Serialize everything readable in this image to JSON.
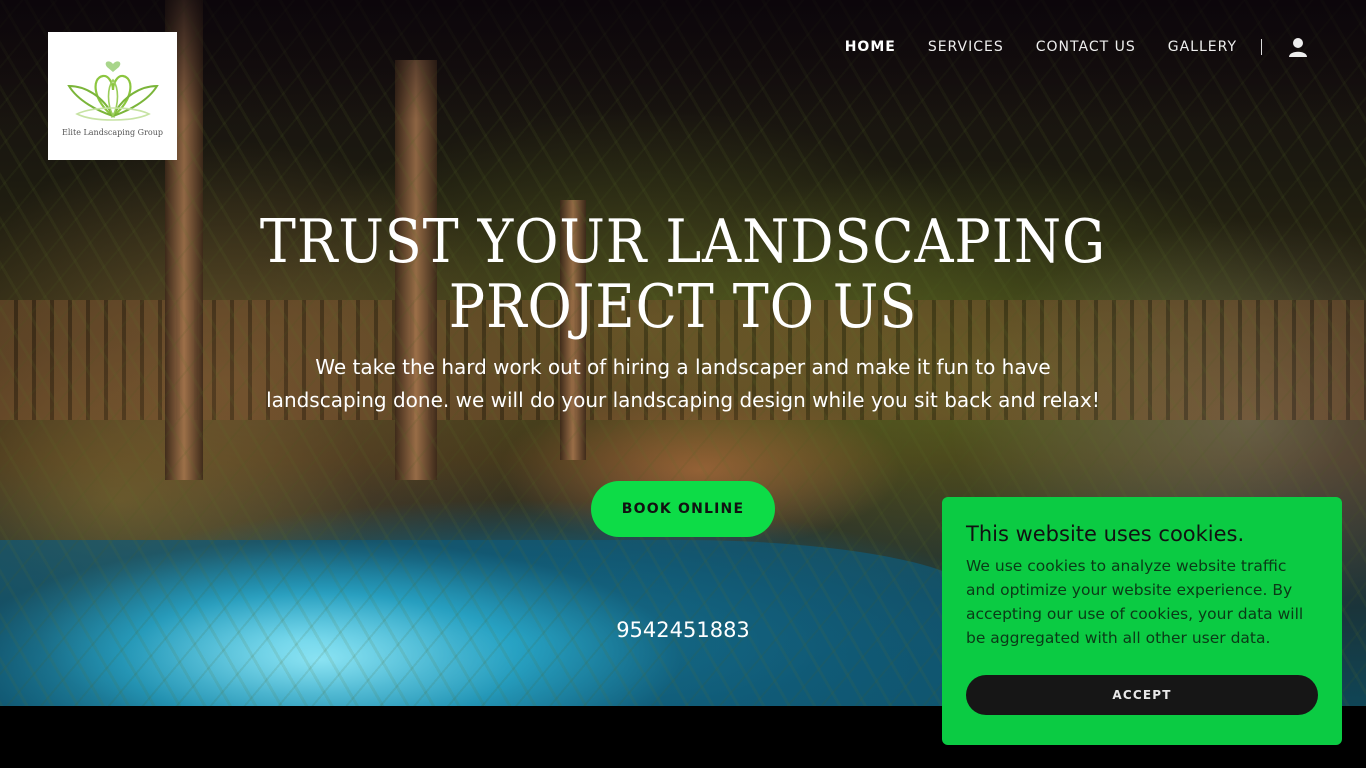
{
  "brand": {
    "logo_text": "Elite Landscaping Group",
    "logo_color": "#8cc63f"
  },
  "nav": {
    "items": [
      {
        "label": "HOME",
        "active": true
      },
      {
        "label": "SERVICES",
        "active": false
      },
      {
        "label": "CONTACT US",
        "active": false
      },
      {
        "label": "GALLERY",
        "active": false
      }
    ],
    "account_icon": "user-icon"
  },
  "hero": {
    "title_line1": "TRUST YOUR LANDSCAPING",
    "title_line2": "PROJECT TO US",
    "subtitle": "We take the hard work out of hiring a landscaper and make it fun to have landscaping done. we will do your landscaping design while you sit back and relax!",
    "cta_label": "BOOK ONLINE",
    "phone": "9542451883"
  },
  "cookie_banner": {
    "title": "This website uses cookies.",
    "body": "We use cookies to analyze website traffic and optimize your website experience. By accepting our use of cookies, your data will be aggregated with all other user data.",
    "accept_label": "ACCEPT"
  },
  "colors": {
    "accent_green": "#0ddc47",
    "cookie_bg": "#0bcb43",
    "accept_bg": "#161616"
  }
}
